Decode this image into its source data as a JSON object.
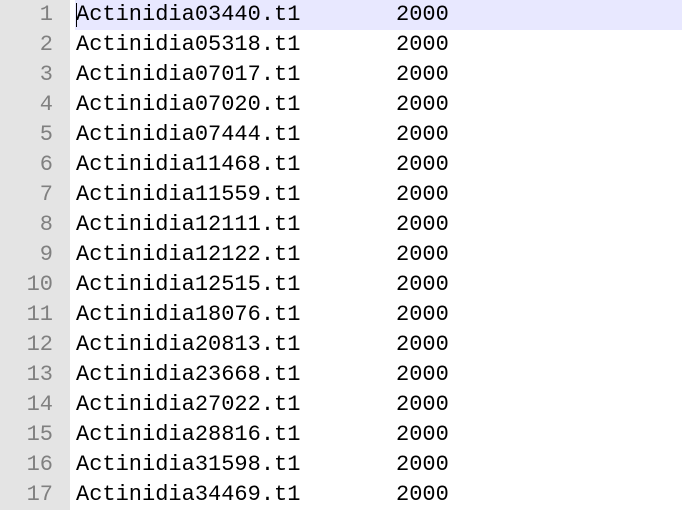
{
  "lines": [
    {
      "num": "1",
      "id": "Actinidia03440.t1",
      "value": "2000"
    },
    {
      "num": "2",
      "id": "Actinidia05318.t1",
      "value": "2000"
    },
    {
      "num": "3",
      "id": "Actinidia07017.t1",
      "value": "2000"
    },
    {
      "num": "4",
      "id": "Actinidia07020.t1",
      "value": "2000"
    },
    {
      "num": "5",
      "id": "Actinidia07444.t1",
      "value": "2000"
    },
    {
      "num": "6",
      "id": "Actinidia11468.t1",
      "value": "2000"
    },
    {
      "num": "7",
      "id": "Actinidia11559.t1",
      "value": "2000"
    },
    {
      "num": "8",
      "id": "Actinidia12111.t1",
      "value": "2000"
    },
    {
      "num": "9",
      "id": "Actinidia12122.t1",
      "value": "2000"
    },
    {
      "num": "10",
      "id": "Actinidia12515.t1",
      "value": "2000"
    },
    {
      "num": "11",
      "id": "Actinidia18076.t1",
      "value": "2000"
    },
    {
      "num": "12",
      "id": "Actinidia20813.t1",
      "value": "2000"
    },
    {
      "num": "13",
      "id": "Actinidia23668.t1",
      "value": "2000"
    },
    {
      "num": "14",
      "id": "Actinidia27022.t1",
      "value": "2000"
    },
    {
      "num": "15",
      "id": "Actinidia28816.t1",
      "value": "2000"
    },
    {
      "num": "16",
      "id": "Actinidia31598.t1",
      "value": "2000"
    },
    {
      "num": "17",
      "id": "Actinidia34469.t1",
      "value": "2000"
    }
  ],
  "colors": {
    "gutter_bg": "#e4e4e4",
    "line_number": "#808080",
    "current_line_bg": "#e8e8ff",
    "text": "#000000"
  }
}
